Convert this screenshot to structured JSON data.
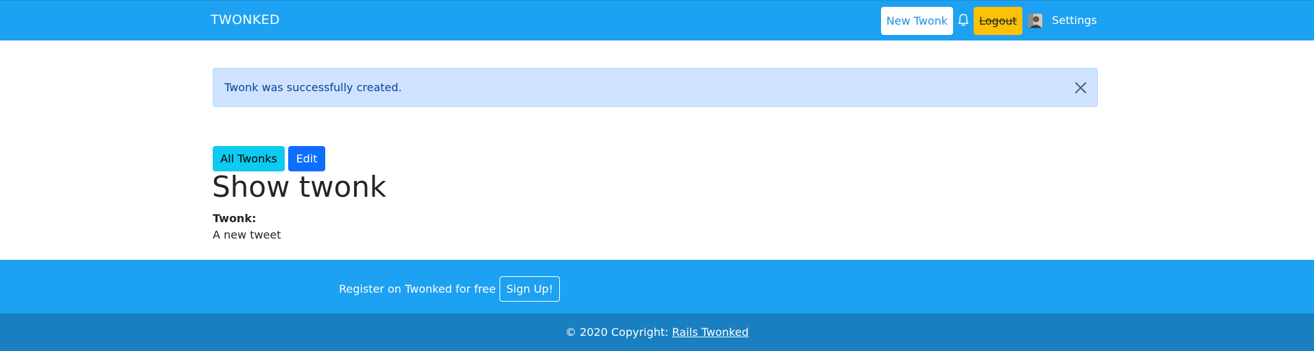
{
  "navbar": {
    "brand": "TWONKED",
    "new_twonk": "New Twonk",
    "logout": "Logout",
    "settings": "Settings"
  },
  "alert": {
    "message": "Twonk was successfully created."
  },
  "actions": {
    "all_twonks": "All Twonks",
    "edit": "Edit"
  },
  "main": {
    "title": "Show twonk",
    "field_label": "Twonk:",
    "field_value": "A new tweet"
  },
  "footer": {
    "register_text": "Register on Twonked for free",
    "signup": "Sign Up!",
    "copyright_prefix": "© 2020 Copyright: ",
    "copyright_link": "Rails Twonked"
  },
  "colors": {
    "brand_blue": "#1da1f2",
    "footer_dark": "#1a7fc1",
    "warning": "#ffc107",
    "info": "#0dcaf0",
    "primary": "#0d6efd",
    "alert_bg": "#cfe2ff"
  },
  "icons": [
    "bell-icon",
    "close-icon",
    "avatar"
  ]
}
